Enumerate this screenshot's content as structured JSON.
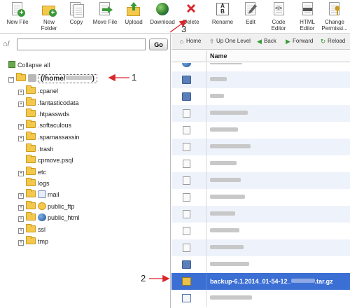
{
  "toolbar": {
    "new_file": "New File",
    "new_folder": "New\nFolder",
    "copy": "Copy",
    "move_file": "Move File",
    "upload": "Upload",
    "download": "Download",
    "delete": "Delete",
    "rename": "Rename",
    "edit": "Edit",
    "code_editor": "Code\nEditor",
    "html_editor": "HTML\nEditor",
    "change_permissions": "Change\nPermissi..."
  },
  "path_bar": {
    "value": "",
    "go_label": "Go"
  },
  "tree": {
    "collapse_all": "Collapse all",
    "root_label": "(/home/",
    "root_suffix": ")",
    "items": [
      {
        "label": ".cpanel"
      },
      {
        "label": ".fantasticodata"
      },
      {
        "label": ".htpasswds"
      },
      {
        "label": ".softaculous"
      },
      {
        "label": ".spamassassin"
      },
      {
        "label": ".trash"
      },
      {
        "label": "cpmove.psql"
      },
      {
        "label": "etc"
      },
      {
        "label": "logs"
      },
      {
        "label": "mail"
      },
      {
        "label": "public_ftp"
      },
      {
        "label": "public_html"
      },
      {
        "label": "ssl"
      },
      {
        "label": "tmp"
      }
    ]
  },
  "nav": {
    "home": "Home",
    "up_one_level": "Up One Level",
    "back": "Back",
    "forward": "Forward",
    "reload": "Reload"
  },
  "file_list": {
    "column_name": "Name",
    "selected_file_prefix": "backup-6.1.2014_01-54-12_",
    "selected_file_suffix": ".tar.gz"
  },
  "annotations": {
    "one": "1",
    "two": "2",
    "three": "3"
  },
  "colors": {
    "selection": "#3b6fd3",
    "folder_yellow": "#f2c94c",
    "folder_blue": "#5b7fb8",
    "arrow_red": "#d9262b"
  }
}
